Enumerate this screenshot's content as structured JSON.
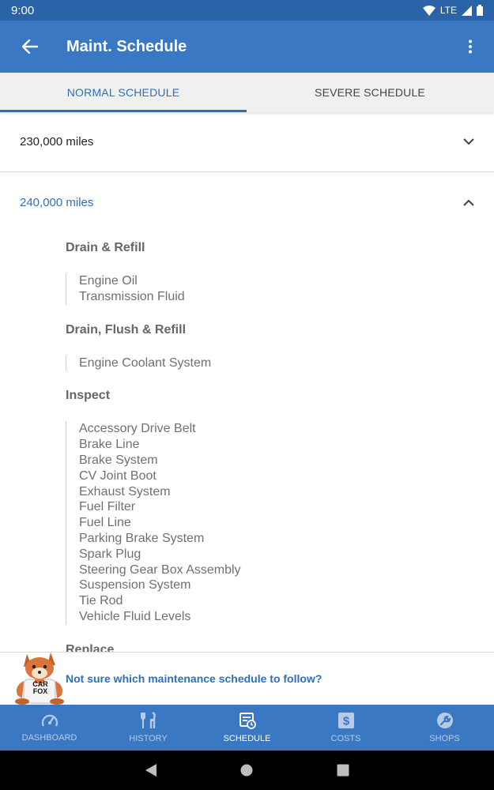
{
  "status_bar": {
    "time": "9:00",
    "network": "LTE"
  },
  "app_bar": {
    "title": "Maint. Schedule"
  },
  "tabs": [
    {
      "label": "NORMAL SCHEDULE",
      "active": true
    },
    {
      "label": "SEVERE SCHEDULE",
      "active": false
    }
  ],
  "intervals": [
    {
      "label": "230,000 miles",
      "expanded": false
    },
    {
      "label": "240,000 miles",
      "expanded": true
    }
  ],
  "groups": [
    {
      "title": "Drain & Refill",
      "items": [
        "Engine Oil",
        "Transmission Fluid"
      ]
    },
    {
      "title": "Drain, Flush & Refill",
      "items": [
        "Engine Coolant System"
      ]
    },
    {
      "title": "Inspect",
      "items": [
        "Accessory Drive Belt",
        "Brake Line",
        "Brake System",
        "CV Joint Boot",
        "Exhaust System",
        "Fuel Filter",
        "Fuel Line",
        "Parking Brake System",
        "Spark Plug",
        "Steering Gear Box Assembly",
        "Suspension System",
        "Tie Rod",
        "Vehicle Fluid Levels"
      ]
    },
    {
      "title": "Replace",
      "items": []
    }
  ],
  "banner": {
    "text": "Not sure which maintenance schedule to follow?",
    "mascot_text": "CAR FOX"
  },
  "bottom_nav": [
    {
      "label": "DASHBOARD",
      "icon": "speedometer-icon",
      "active": false
    },
    {
      "label": "HISTORY",
      "icon": "tools-icon",
      "active": false
    },
    {
      "label": "SCHEDULE",
      "icon": "schedule-icon",
      "active": true
    },
    {
      "label": "COSTS",
      "icon": "dollar-icon",
      "active": false
    },
    {
      "label": "SHOPS",
      "icon": "wrench-circle-icon",
      "active": false
    }
  ],
  "colors": {
    "primary": "#3a78c4",
    "status_bar": "#2b63a8",
    "accent": "#2f6fb9"
  }
}
